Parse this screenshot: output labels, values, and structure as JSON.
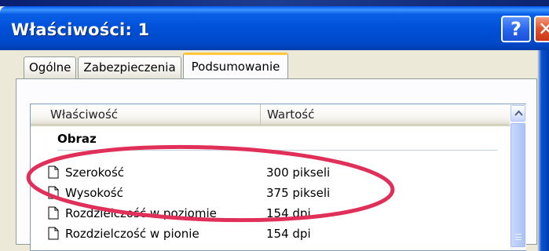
{
  "window": {
    "title": "Właściwości: 1",
    "help_label": "?",
    "close_label": "✕"
  },
  "tabs": [
    {
      "label": "Ogólne",
      "active": false
    },
    {
      "label": "Zabezpieczenia",
      "active": false
    },
    {
      "label": "Podsumowanie",
      "active": true
    }
  ],
  "listview": {
    "columns": [
      "Właściwość",
      "Wartość"
    ],
    "group": "Obraz",
    "rows": [
      {
        "name": "Szerokość",
        "value": "300 pikseli",
        "icon": "document-icon"
      },
      {
        "name": "Wysokość",
        "value": "375 pikseli",
        "icon": "document-icon"
      },
      {
        "name": "Rozdzielczość w poziomie",
        "value": "154 dpi",
        "icon": "document-icon"
      },
      {
        "name": "Rozdzielczość w pionie",
        "value": "154 dpi",
        "icon": "document-icon"
      }
    ]
  },
  "annotation": {
    "color": "#e0305a",
    "shape": "ellipse"
  }
}
